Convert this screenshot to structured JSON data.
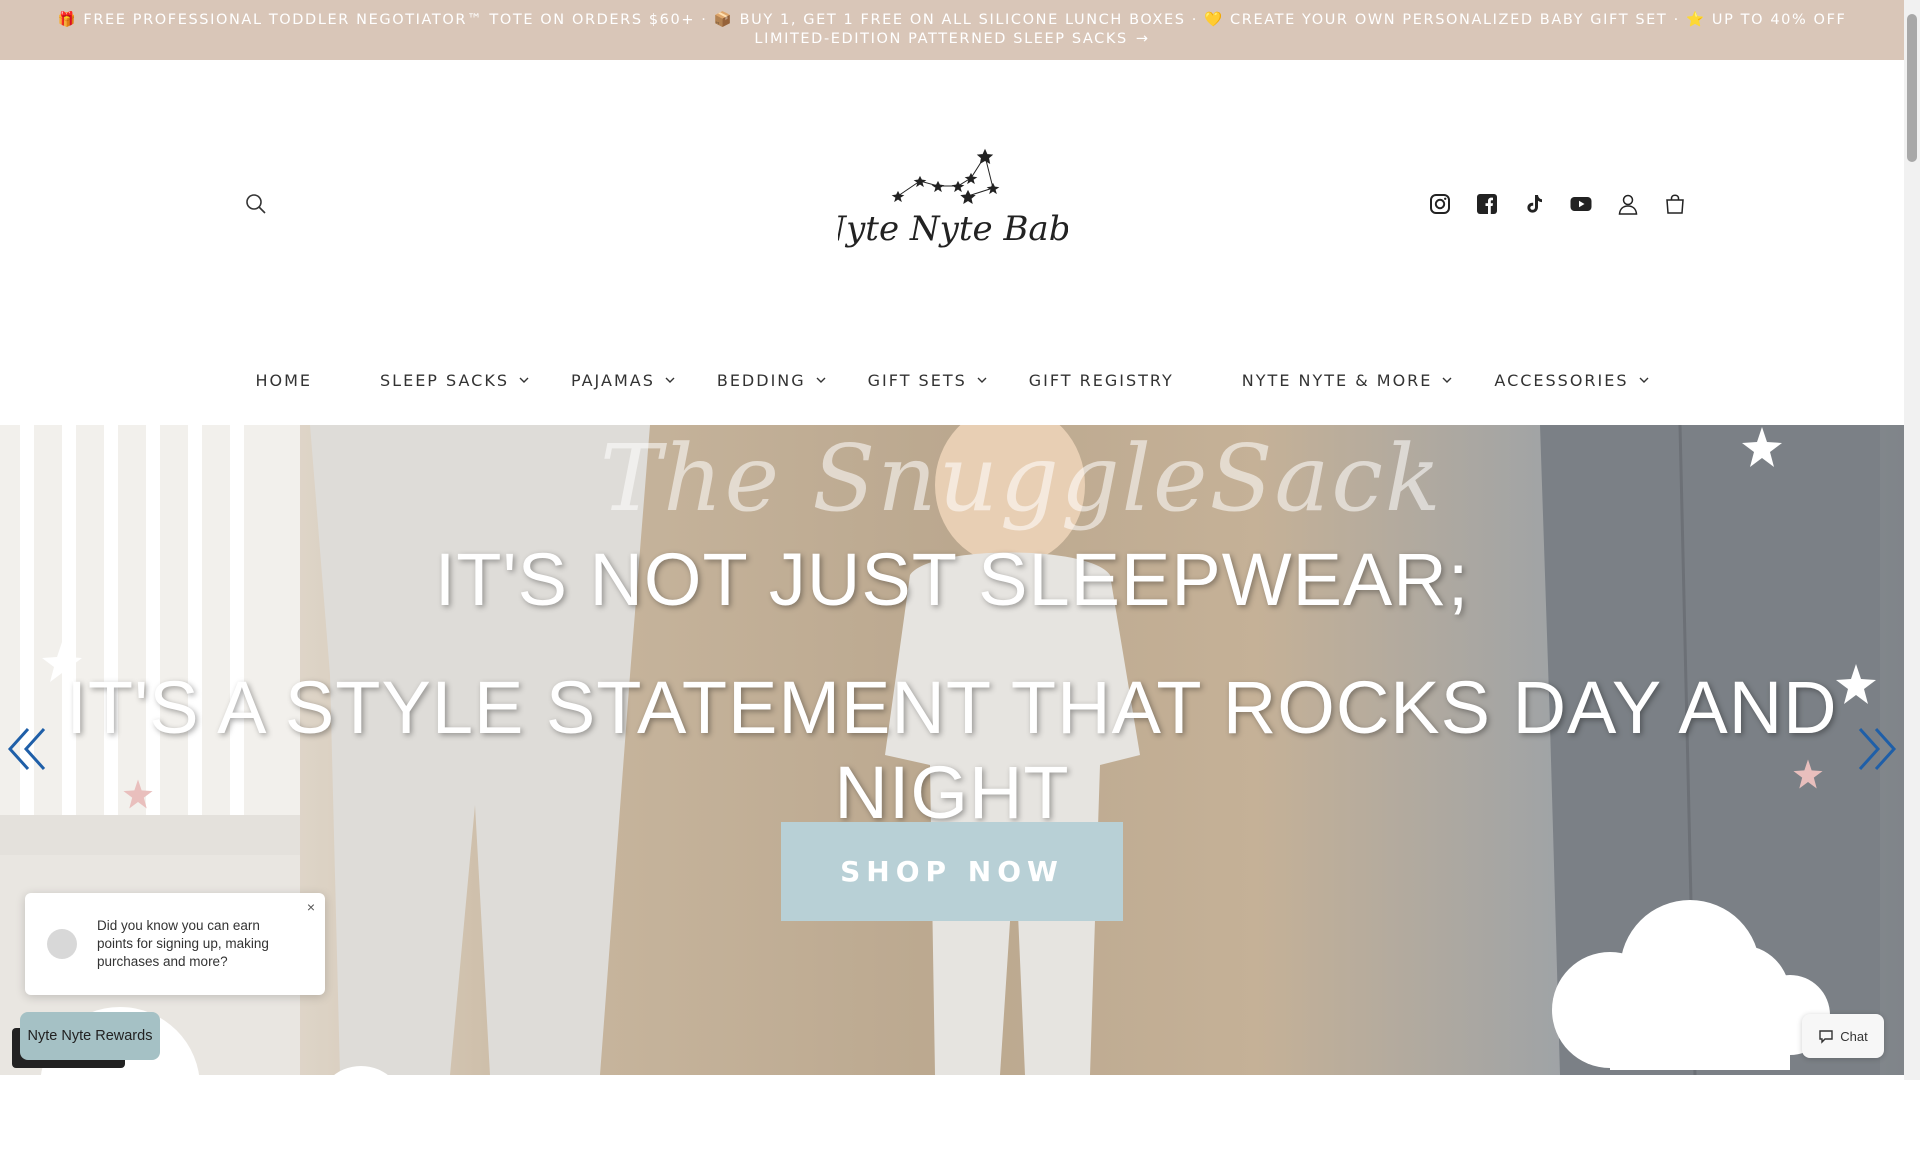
{
  "announcement": {
    "text": "🎁 FREE PROFESSIONAL TODDLER NEGOTIATOR™ TOTE ON ORDERS $60+ · 📦 BUY 1, GET 1 FREE ON ALL SILICONE LUNCH BOXES · 💛 CREATE YOUR OWN PERSONALIZED BABY GIFT SET · ⭐ UP TO 40% OFF LIMITED-EDITION PATTERNED SLEEP SACKS",
    "arrow": "→",
    "background": "#d9c6b8"
  },
  "header": {
    "logo_text": "Nyte Nyte Baby",
    "icons": [
      "search-icon",
      "instagram-icon",
      "facebook-icon",
      "tiktok-icon",
      "youtube-icon",
      "account-icon",
      "cart-icon"
    ]
  },
  "nav": {
    "items": [
      {
        "label": "HOME",
        "has_dropdown": false
      },
      {
        "label": "SLEEP SACKS",
        "has_dropdown": true
      },
      {
        "label": "PAJAMAS",
        "has_dropdown": true
      },
      {
        "label": "BEDDING",
        "has_dropdown": true
      },
      {
        "label": "GIFT SETS",
        "has_dropdown": true
      },
      {
        "label": "GIFT REGISTRY",
        "has_dropdown": false
      },
      {
        "label": "NYTE NYTE & MORE",
        "has_dropdown": true
      },
      {
        "label": "ACCESSORIES",
        "has_dropdown": true
      }
    ]
  },
  "hero": {
    "script_title": "The SnuggleSack",
    "line1": "IT'S NOT JUST SLEEPWEAR;",
    "line2": "IT'S A STYLE STATEMENT THAT ROCKS DAY AND NIGHT",
    "cta": "SHOP NOW",
    "cta_color": "#b8d0d6",
    "arrow_color": "#1f5fa8"
  },
  "rewards_popup": {
    "text": "Did you know you can earn points for signing up, making purchases and more?",
    "close": "×"
  },
  "rewards_button": {
    "label": "Nyte Nyte Rewards"
  },
  "chat": {
    "label": "Chat"
  }
}
